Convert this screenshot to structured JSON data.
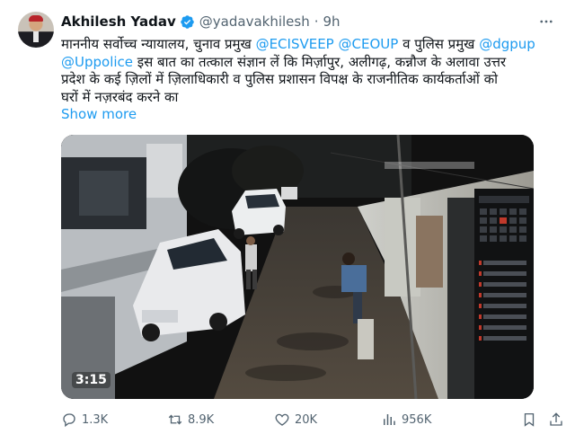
{
  "author": {
    "name": "Akhilesh Yadav",
    "handle": "@yadavakhilesh",
    "separator": "·",
    "time": "9h"
  },
  "tweet": {
    "line1_prefix": "माननीय सर्वोच्च न्यायालय, चुनाव प्रमुख ",
    "mention_ecisveep": "@ECISVEEP",
    "mention_ceoup": "@CEOUP",
    "line1_mid": " व पुलिस प्रमुख ",
    "mention_dgpup": "@dgpup",
    "mention_uppolice": "@Uppolice",
    "line2_rest": " इस बात का तत्काल संज्ञान लें कि मिर्ज़ापुर, अलीगढ़, कन्नौज के अलावा उत्तर",
    "line3": "प्रदेश के कई ज़िलों में ज़िलाधिकारी व पुलिस प्रशासन विपक्ष के राजनीतिक कार्यकर्ताओं को",
    "line4": "घरों में नज़रबंद करने का",
    "show_more": "Show more"
  },
  "media": {
    "duration": "3:15"
  },
  "stats": {
    "replies": "1.3K",
    "reposts": "8.9K",
    "likes": "20K",
    "views": "956K"
  },
  "icons": {
    "more": "more-options-icon",
    "verified": "verified-badge-icon",
    "reply": "reply-icon",
    "repost": "repost-icon",
    "like": "heart-icon",
    "views": "views-chart-icon",
    "bookmark": "bookmark-icon",
    "share": "share-icon"
  },
  "colors": {
    "accent": "#1d9bf0",
    "text": "#0f1419",
    "secondary": "#536471"
  }
}
